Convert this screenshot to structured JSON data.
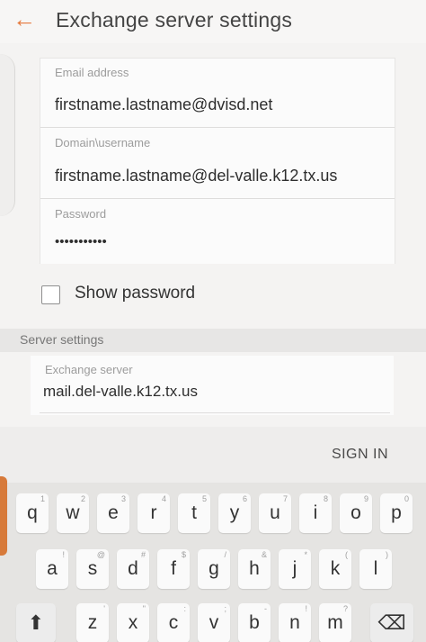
{
  "header": {
    "back_icon": "←",
    "title": "Exchange server settings"
  },
  "account": {
    "email_label": "Email address",
    "email_value": "firstname.lastname@dvisd.net",
    "domain_label": "Domain\\username",
    "domain_value": "firstname.lastname@del-valle.k12.tx.us",
    "password_label": "Password",
    "password_value": "•••••••••••"
  },
  "show_password": {
    "label": "Show password",
    "checked": false
  },
  "server_settings": {
    "section_title": "Server settings",
    "server_label": "Exchange server",
    "server_value": "mail.del-valle.k12.tx.us"
  },
  "keyboard": {
    "sign_in_label": "SIGN IN",
    "row1": [
      {
        "char": "q",
        "hint": "1"
      },
      {
        "char": "w",
        "hint": "2"
      },
      {
        "char": "e",
        "hint": "3"
      },
      {
        "char": "r",
        "hint": "4"
      },
      {
        "char": "t",
        "hint": "5"
      },
      {
        "char": "y",
        "hint": "6"
      },
      {
        "char": "u",
        "hint": "7"
      },
      {
        "char": "i",
        "hint": "8"
      },
      {
        "char": "o",
        "hint": "9"
      },
      {
        "char": "p",
        "hint": "0"
      }
    ],
    "row2": [
      {
        "char": "a",
        "hint": "!"
      },
      {
        "char": "s",
        "hint": "@"
      },
      {
        "char": "d",
        "hint": "#"
      },
      {
        "char": "f",
        "hint": "$"
      },
      {
        "char": "g",
        "hint": "/"
      },
      {
        "char": "h",
        "hint": "&"
      },
      {
        "char": "j",
        "hint": "*"
      },
      {
        "char": "k",
        "hint": "("
      },
      {
        "char": "l",
        "hint": ")"
      }
    ],
    "row3": [
      {
        "char": "z",
        "hint": "'"
      },
      {
        "char": "x",
        "hint": "\""
      },
      {
        "char": "c",
        "hint": ":"
      },
      {
        "char": "v",
        "hint": ";"
      },
      {
        "char": "b",
        "hint": "-"
      },
      {
        "char": "n",
        "hint": "!"
      },
      {
        "char": "m",
        "hint": "?"
      }
    ],
    "shift_icon": "⬆",
    "backspace_icon": "⌫"
  },
  "colors": {
    "accent": "#e67a3e"
  }
}
